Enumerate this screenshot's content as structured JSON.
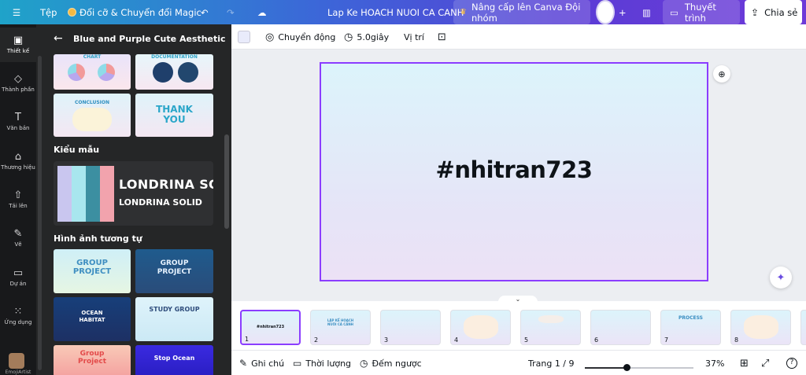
{
  "topbar": {
    "menu_icon": "hamburger-icon",
    "file_label": "Tệp",
    "magic_label": "Đổi cỡ & Chuyển đổi Magic",
    "doc_title": "Lap Ke HOACH NUOI CA CANH",
    "upgrade_label": "Nâng cấp lên Canva Đội nhóm",
    "present_label": "Thuyết trình",
    "share_label": "Chia sẻ"
  },
  "rail": {
    "items": [
      {
        "label": "Thiết kế",
        "icon": "design-icon"
      },
      {
        "label": "Thành phần",
        "icon": "elements-icon"
      },
      {
        "label": "Văn bản",
        "icon": "text-icon"
      },
      {
        "label": "Thương hiệu",
        "icon": "brand-icon"
      },
      {
        "label": "Tải lên",
        "icon": "upload-icon"
      },
      {
        "label": "Vẽ",
        "icon": "draw-icon"
      },
      {
        "label": "Dự án",
        "icon": "projects-icon"
      },
      {
        "label": "Ứng dụng",
        "icon": "apps-icon"
      }
    ],
    "user_label": "EmojiArtist"
  },
  "panel": {
    "title": "Blue and Purple Cute Aesthetic Group...",
    "template_thumbs": [
      {
        "label": "CHART"
      },
      {
        "label": "DOCUMENTATION"
      },
      {
        "label": "CONCLUSION"
      },
      {
        "label": "THANK YOU"
      }
    ],
    "style_heading": "Kiểu mẫu",
    "font_primary": "LONDRINA SOLID",
    "font_secondary": "LONDRINA SOLID",
    "palette": [
      "#c9c6ef",
      "#a8e6ee",
      "#3c8fa1",
      "#f2a3ad"
    ],
    "similar_heading": "Hình ảnh tương tự",
    "similar_thumbs": [
      {
        "label": "GROUP PROJECT"
      },
      {
        "label": "GROUP PROJECT"
      },
      {
        "label": "OCEAN HABITAT"
      },
      {
        "label": "STUDY GROUP"
      },
      {
        "label": "Group Project"
      },
      {
        "label": "Stop Ocean"
      }
    ]
  },
  "toolbar": {
    "animate_label": "Chuyển động",
    "duration_label": "5.0giây",
    "position_label": "Vị trí"
  },
  "slide": {
    "text": "#nhitran723"
  },
  "filmstrip": {
    "pages": [
      {
        "num": "1",
        "text": "#nhitran723"
      },
      {
        "num": "2",
        "text": "LẬP KẾ HOẠCH NUÔI CÁ CẢNH"
      },
      {
        "num": "3",
        "text": ""
      },
      {
        "num": "4",
        "text": ""
      },
      {
        "num": "5",
        "text": ""
      },
      {
        "num": "6",
        "text": ""
      },
      {
        "num": "7",
        "text": "PROCESS"
      },
      {
        "num": "8",
        "text": ""
      }
    ]
  },
  "bottom": {
    "notes_label": "Ghi chú",
    "duration_label": "Thời lượng",
    "timer_label": "Đếm ngược",
    "page_indicator": "Trang 1 / 9",
    "zoom_level": 37,
    "zoom_label": "37%"
  },
  "colors": {
    "accent": "#8b3dff",
    "rail_bg": "#18191b",
    "panel_bg": "#252627"
  }
}
